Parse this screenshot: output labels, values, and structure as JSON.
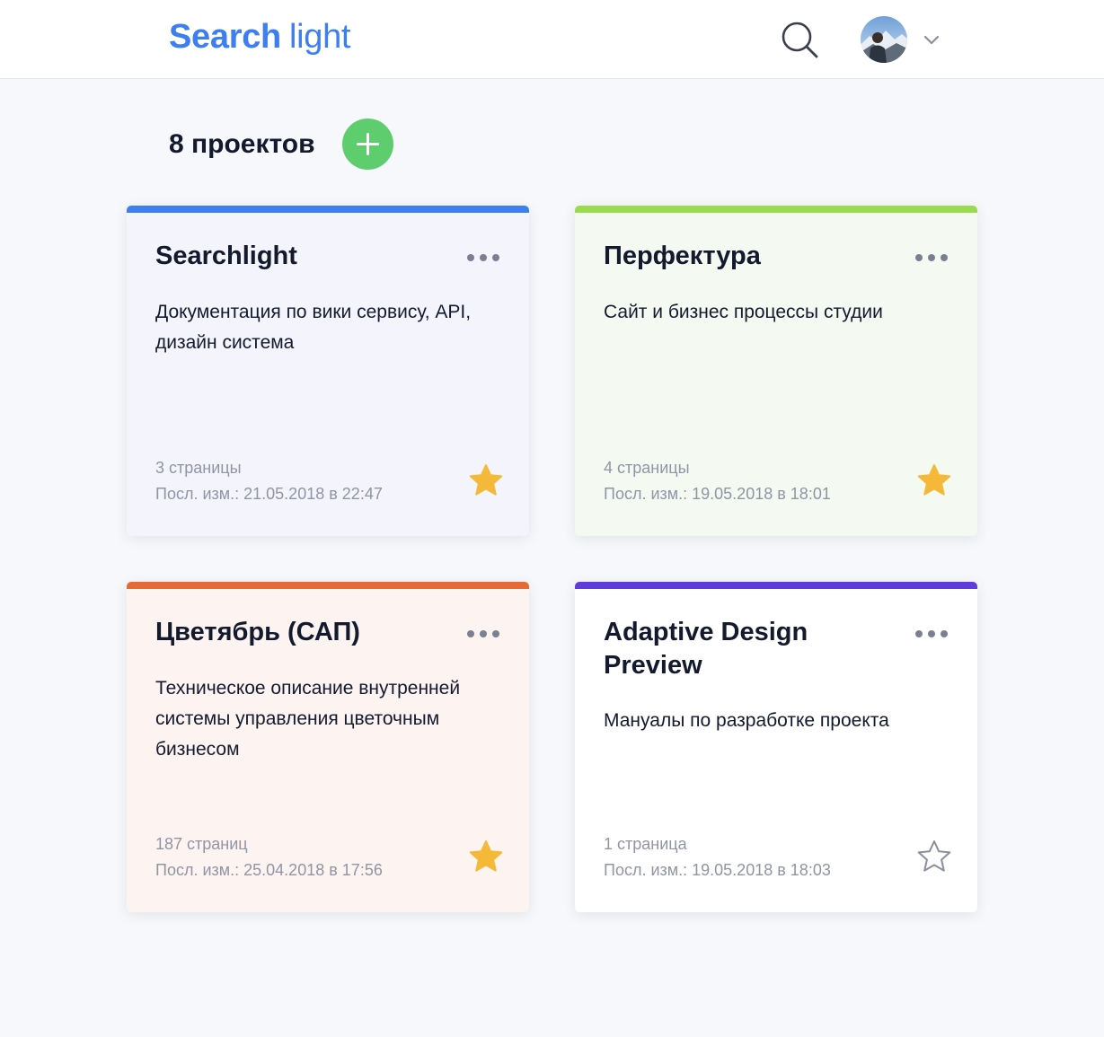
{
  "header": {
    "logo_bold": "Search",
    "logo_light": "light",
    "search_icon": "search-icon",
    "avatar_icon": "user-avatar",
    "menu_icon": "chevron-down-icon"
  },
  "projects": {
    "count_label": "8 проектов",
    "add_icon": "plus-icon",
    "cards": [
      {
        "title": "Searchlight",
        "description": "Документация по вики сервису, API, дизайн система",
        "pages": "3 страницы",
        "modified": "Посл. изм.: 21.05.2018 в 22:47",
        "favorite": true,
        "accent_color": "#3d7ef0",
        "background": "#f3f4fc"
      },
      {
        "title": "Перфектура",
        "description": "Сайт и бизнес процессы студии",
        "pages": "4 страницы",
        "modified": "Посл. изм.: 19.05.2018 в 18:01",
        "favorite": true,
        "accent_color": "#9bd94d",
        "background": "#f4faf2"
      },
      {
        "title": "Цветябрь (САП)",
        "description": "Техническое описание внутренней системы управления цветочным бизнесом",
        "pages": "187 страниц",
        "modified": "Посл. изм.: 25.04.2018 в 17:56",
        "favorite": true,
        "accent_color": "#e66a36",
        "background": "#fdf3f1"
      },
      {
        "title": "Adaptive Design Preview",
        "description": "Мануалы по разработке проекта",
        "pages": "1 страница",
        "modified": "Посл. изм.: 19.05.2018 в 18:03",
        "favorite": false,
        "accent_color": "#5d3bdc",
        "background": "#ffffff"
      }
    ]
  },
  "colors": {
    "brand": "#3d7ef0",
    "add_button": "#5ecd6e",
    "star_filled": "#f5b93a",
    "star_outline": "#8a8f9c",
    "page_background": "#f7f8fb"
  }
}
